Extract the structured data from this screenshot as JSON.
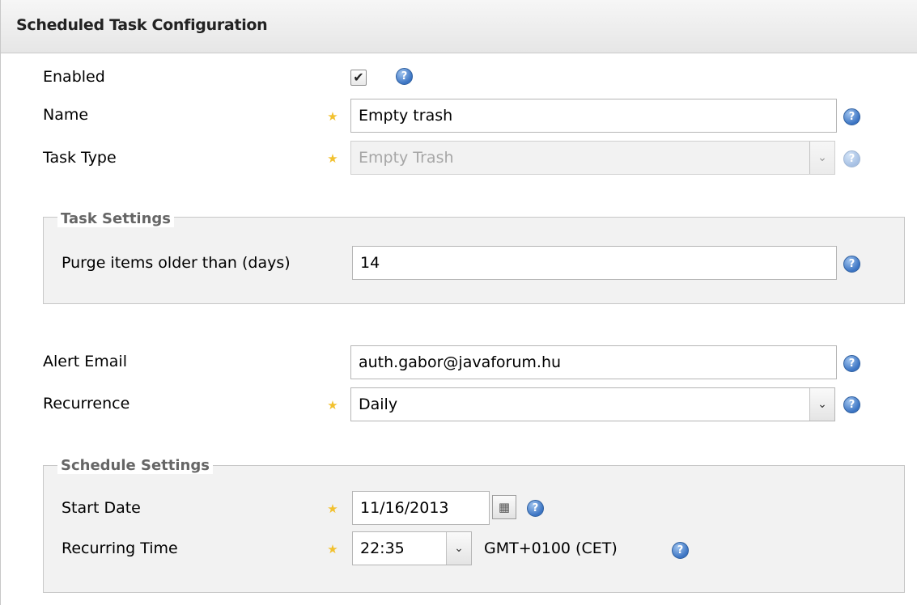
{
  "panel": {
    "title": "Scheduled Task Configuration"
  },
  "enabled": {
    "label": "Enabled",
    "checked": true,
    "check_glyph": "✔"
  },
  "name": {
    "label": "Name",
    "value": "Empty trash"
  },
  "task_type": {
    "label": "Task Type",
    "value": "Empty Trash"
  },
  "task_settings": {
    "legend": "Task Settings",
    "purge": {
      "label": "Purge items older than (days)",
      "value": "14"
    }
  },
  "alert_email": {
    "label": "Alert Email",
    "value": "auth.gabor@javaforum.hu"
  },
  "recurrence": {
    "label": "Recurrence",
    "value": "Daily"
  },
  "schedule_settings": {
    "legend": "Schedule Settings",
    "start_date": {
      "label": "Start Date",
      "value": "11/16/2013"
    },
    "recurring_time": {
      "label": "Recurring Time",
      "value": "22:35",
      "timezone": "GMT+0100 (CET)"
    }
  },
  "icons": {
    "help": "?",
    "required": "★",
    "dropdown": "⌄",
    "calendar": "▦"
  },
  "colors": {
    "required_star": "#f2c12e",
    "help_icon": "#3b74c3"
  }
}
